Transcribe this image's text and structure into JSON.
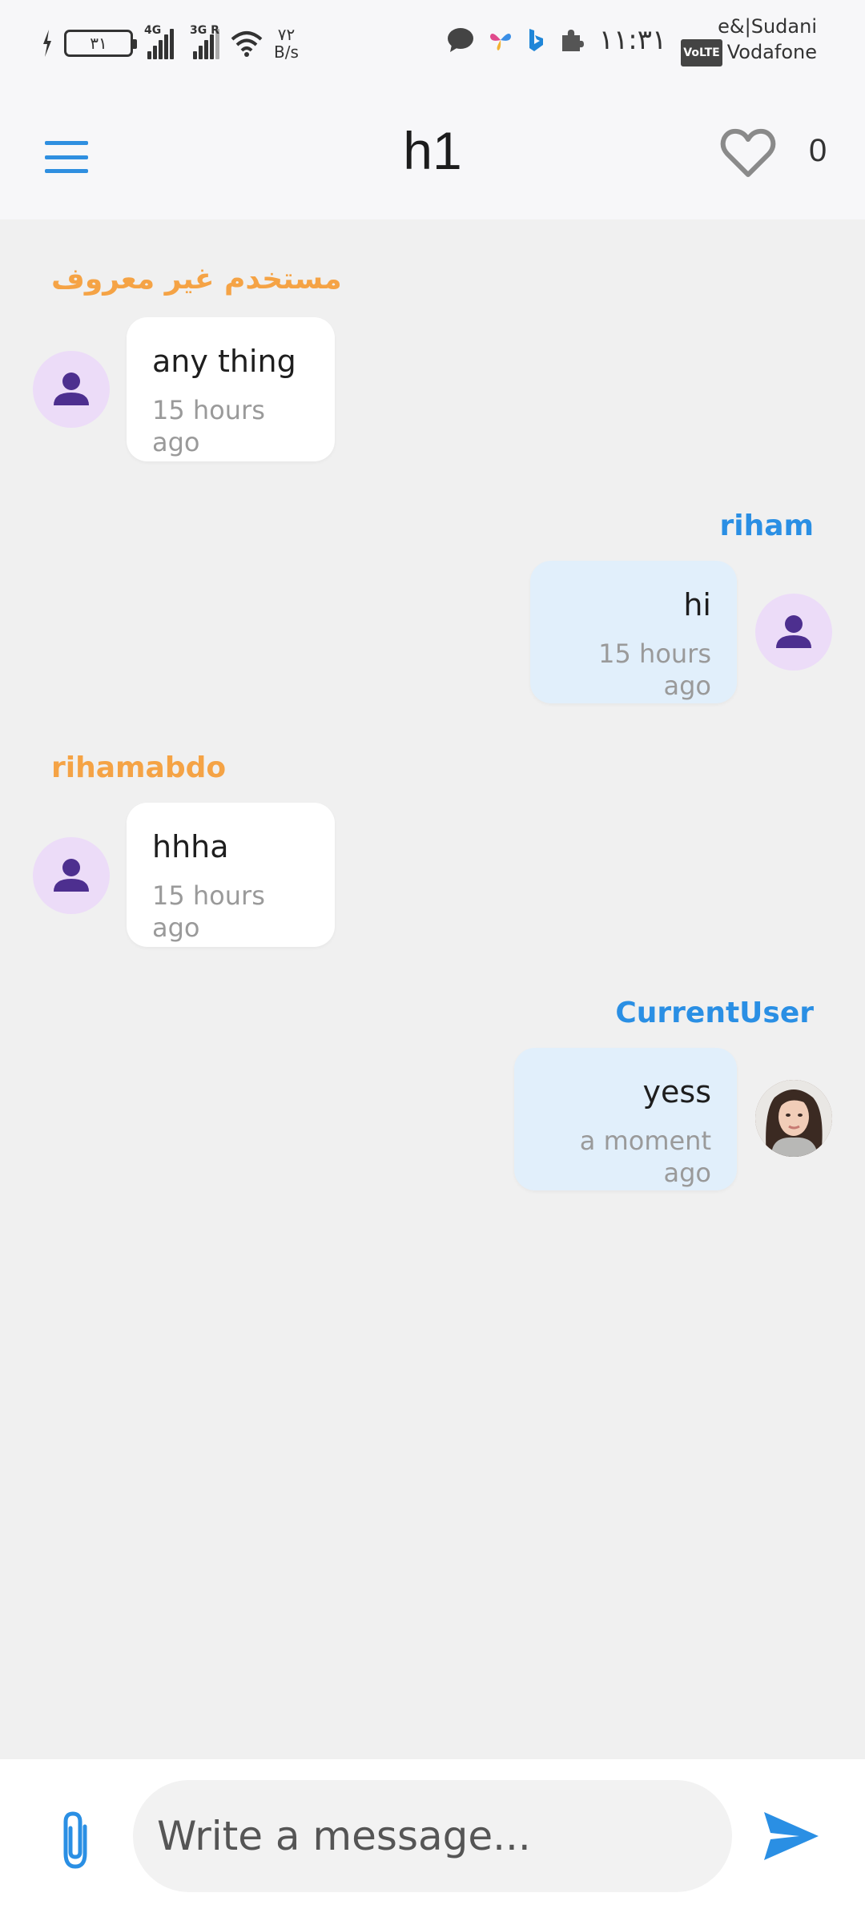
{
  "status_bar": {
    "battery": "٣١",
    "network_1": "4G",
    "network_2": "3G R",
    "speed_value": "٧٢",
    "speed_unit": "B/s",
    "time": "١١:٣١",
    "carrier_1": "e&|Sudani",
    "volte": "VoLTE",
    "carrier_2": "Vodafone"
  },
  "app_bar": {
    "title": "h1",
    "like_count": "0"
  },
  "messages": [
    {
      "sender": "مستخدم غير معروف",
      "text": "any thing",
      "time": "15 hours ago",
      "side": "other"
    },
    {
      "sender": "riham",
      "text": "hi",
      "time": "15 hours ago",
      "side": "me"
    },
    {
      "sender": "rihamabdo",
      "text": "hhha",
      "time": "15 hours ago",
      "side": "other"
    },
    {
      "sender": "CurrentUser",
      "text": "yess",
      "time": "a moment ago",
      "side": "me"
    }
  ],
  "composer": {
    "placeholder": "Write a message..."
  },
  "colors": {
    "accent": "#2a8fe4",
    "other_sender": "#f5a345",
    "bubble_me": "#e1effb",
    "bubble_other": "#ffffff",
    "avatar_bg": "#ecdcf8",
    "avatar_fg": "#4d2f8f"
  },
  "icons": {
    "menu": "hamburger-icon",
    "like": "heart-outline-icon",
    "attach": "paperclip-icon",
    "send": "send-icon",
    "avatar_default": "person-icon"
  }
}
